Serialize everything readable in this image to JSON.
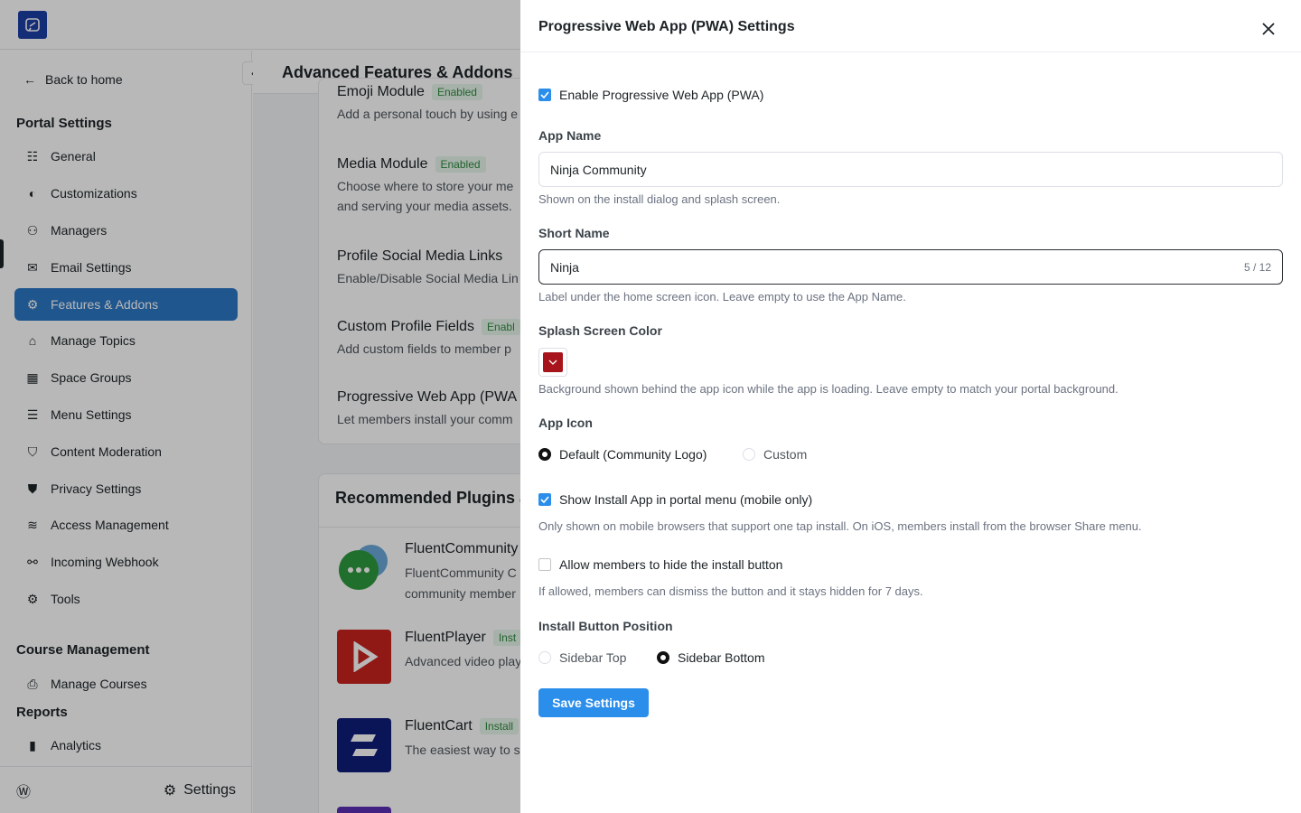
{
  "sidebar": {
    "back_label": "Back to home",
    "portal_settings_title": "Portal Settings",
    "items": [
      {
        "label": "General"
      },
      {
        "label": "Customizations"
      },
      {
        "label": "Managers"
      },
      {
        "label": "Email Settings"
      },
      {
        "label": "Features & Addons"
      },
      {
        "label": "Manage Topics"
      },
      {
        "label": "Space Groups"
      },
      {
        "label": "Menu Settings"
      },
      {
        "label": "Content Moderation"
      },
      {
        "label": "Privacy Settings"
      },
      {
        "label": "Access Management"
      },
      {
        "label": "Incoming Webhook"
      },
      {
        "label": "Tools"
      }
    ],
    "course_title": "Course Management",
    "course_items": [
      {
        "label": "Manage Courses"
      }
    ],
    "reports_title": "Reports",
    "reports_items": [
      {
        "label": "Analytics"
      }
    ],
    "footer_settings": "Settings"
  },
  "main": {
    "title": "Advanced Features & Addons",
    "features": [
      {
        "title": "Emoji Module",
        "badge": "Enabled",
        "desc": "Add a personal touch by using e"
      },
      {
        "title": "Media Module",
        "badge": "Enabled",
        "desc": "Choose where to store your me\nand serving your media assets."
      },
      {
        "title": "Profile Social Media Links",
        "badge": "",
        "desc": "Enable/Disable Social Media Lin"
      },
      {
        "title": "Custom Profile Fields",
        "badge": "Enabl",
        "desc": "Add custom fields to member p"
      },
      {
        "title": "Progressive Web App (PWA",
        "badge": "",
        "desc": "Let members install your comm"
      }
    ],
    "recommended_title": "Recommended Plugins a",
    "plugins": [
      {
        "title": "FluentCommunity",
        "badge": "",
        "desc": "FluentCommunity C\ncommunity member"
      },
      {
        "title": "FluentPlayer",
        "badge": "Inst",
        "desc": "Advanced video play"
      },
      {
        "title": "FluentCart",
        "badge": "Install",
        "desc": "The easiest way to s"
      }
    ]
  },
  "drawer": {
    "title": "Progressive Web App (PWA) Settings",
    "enable_label": "Enable Progressive Web App (PWA)",
    "enable_checked": true,
    "app_name": {
      "label": "App Name",
      "value": "Ninja Community",
      "help": "Shown on the install dialog and splash screen."
    },
    "short_name": {
      "label": "Short Name",
      "value": "Ninja",
      "counter": "5 / 12",
      "help": "Label under the home screen icon. Leave empty to use the App Name."
    },
    "splash": {
      "label": "Splash Screen Color",
      "color": "#a8141b",
      "help": "Background shown behind the app icon while the app is loading. Leave empty to match your portal background."
    },
    "app_icon": {
      "label": "App Icon",
      "options": [
        "Default (Community Logo)",
        "Custom"
      ],
      "selected": "Default (Community Logo)"
    },
    "show_install": {
      "label": "Show Install App in portal menu (mobile only)",
      "checked": true,
      "help": "Only shown on mobile browsers that support one tap install. On iOS, members install from the browser Share menu."
    },
    "allow_hide": {
      "label": "Allow members to hide the install button",
      "checked": false,
      "help": "If allowed, members can dismiss the button and it stays hidden for 7 days."
    },
    "position": {
      "label": "Install Button Position",
      "options": [
        "Sidebar Top",
        "Sidebar Bottom"
      ],
      "selected": "Sidebar Bottom"
    },
    "save_label": "Save Settings"
  },
  "colors": {
    "primary": "#2b8eea",
    "nav_active": "#2b78c5",
    "splash": "#a8141b"
  }
}
